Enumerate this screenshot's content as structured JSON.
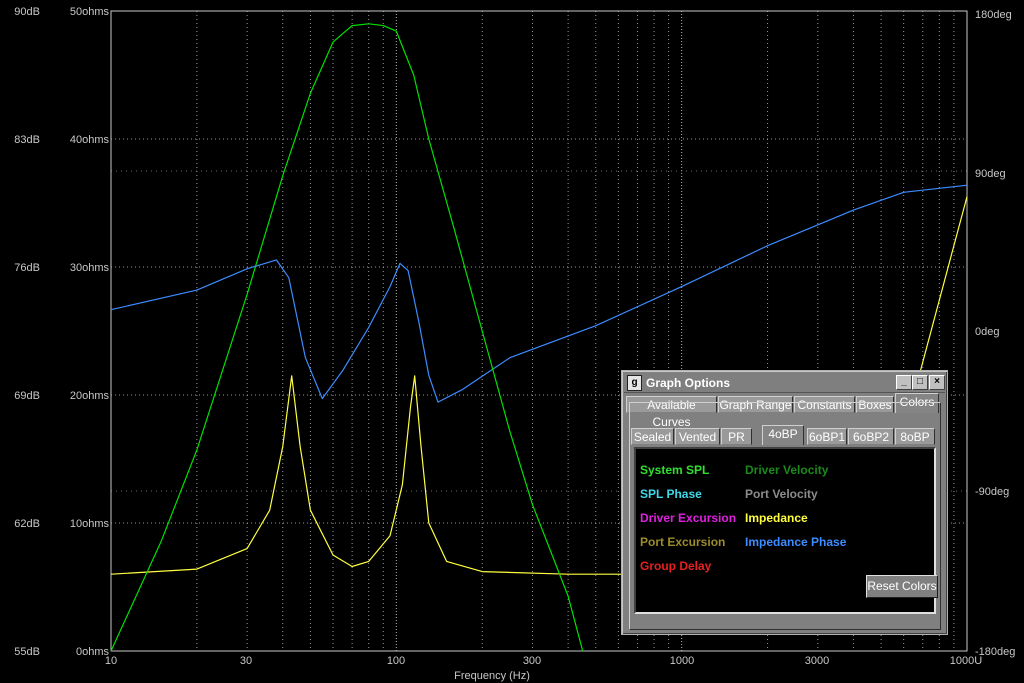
{
  "graph": {
    "left_axis_spl": [
      "90dB",
      "83dB",
      "76dB",
      "69dB",
      "62dB",
      "55dB"
    ],
    "left_axis_impedance": [
      "50ohms",
      "40ohms",
      "30ohms",
      "20ohms",
      "10ohms",
      "0ohms"
    ],
    "right_axis_phase": [
      "180deg",
      "90deg",
      "0deg",
      "-90deg",
      "-180deg"
    ],
    "x_ticks": [
      "10",
      "30",
      "100",
      "300",
      "1000",
      "3000",
      "1000U"
    ],
    "x_label": "Frequency (Hz)",
    "colors": {
      "spl": "#00e000",
      "impedance": "#ffff40",
      "impedance_phase": "#3c8cff",
      "grid": "#9a9a9a",
      "frame": "#c8c8c8"
    },
    "spl_curve": [
      [
        10,
        55
      ],
      [
        15,
        61
      ],
      [
        20,
        66
      ],
      [
        30,
        74.5
      ],
      [
        40,
        81
      ],
      [
        50,
        85.5
      ],
      [
        60,
        88.3
      ],
      [
        70,
        89.2
      ],
      [
        80,
        89.3
      ],
      [
        90,
        89.2
      ],
      [
        100,
        88.9
      ],
      [
        115,
        86.5
      ],
      [
        130,
        83
      ],
      [
        160,
        78
      ],
      [
        200,
        72.5
      ],
      [
        250,
        67
      ],
      [
        300,
        63
      ],
      [
        400,
        58
      ],
      [
        450,
        55
      ]
    ],
    "impedance_curve": [
      [
        10,
        6
      ],
      [
        20,
        6.4
      ],
      [
        30,
        8
      ],
      [
        36,
        11
      ],
      [
        40,
        16
      ],
      [
        43,
        21.5
      ],
      [
        46,
        16
      ],
      [
        50,
        11
      ],
      [
        60,
        7.5
      ],
      [
        70,
        6.6
      ],
      [
        80,
        7
      ],
      [
        95,
        9
      ],
      [
        105,
        13
      ],
      [
        112,
        19
      ],
      [
        116,
        21.5
      ],
      [
        122,
        16
      ],
      [
        130,
        10
      ],
      [
        150,
        7
      ],
      [
        200,
        6.2
      ],
      [
        400,
        6
      ],
      [
        800,
        6
      ],
      [
        1500,
        6.5
      ],
      [
        2500,
        8
      ],
      [
        4000,
        11
      ],
      [
        6000,
        17
      ],
      [
        10000,
        35.5
      ]
    ],
    "phase_curve": [
      [
        10,
        12
      ],
      [
        20,
        23
      ],
      [
        30,
        35
      ],
      [
        38,
        40
      ],
      [
        42,
        30
      ],
      [
        48,
        -15
      ],
      [
        55,
        -38
      ],
      [
        65,
        -22
      ],
      [
        80,
        2
      ],
      [
        95,
        25
      ],
      [
        103,
        38
      ],
      [
        110,
        34
      ],
      [
        120,
        5
      ],
      [
        130,
        -25
      ],
      [
        140,
        -40
      ],
      [
        170,
        -33
      ],
      [
        250,
        -15
      ],
      [
        500,
        3
      ],
      [
        1000,
        25
      ],
      [
        2000,
        48
      ],
      [
        4000,
        68
      ],
      [
        6000,
        78
      ],
      [
        10000,
        82
      ]
    ]
  },
  "dialog": {
    "title": "Graph Options",
    "icon_glyph": "g",
    "minimize": "_",
    "maximize": "□",
    "close": "×",
    "top_tabs": [
      "Available Curves",
      "Graph Range",
      "Constants",
      "Boxes",
      "Colors"
    ],
    "sub_tabs": [
      "Sealed",
      "Vented",
      "PR",
      "4oBP",
      "6oBP1",
      "6oBP2",
      "8oBP"
    ],
    "color_labels": [
      {
        "text": "System SPL",
        "color": "#30e030"
      },
      {
        "text": "Driver Velocity",
        "color": "#1a8a1a"
      },
      {
        "text": "SPL Phase",
        "color": "#40d8e8"
      },
      {
        "text": "Port Velocity",
        "color": "#8c8c8c"
      },
      {
        "text": "Driver Excursion",
        "color": "#e020e0"
      },
      {
        "text": "Impedance",
        "color": "#ffff40"
      },
      {
        "text": "Port Excursion",
        "color": "#9c8c2c"
      },
      {
        "text": "Impedance Phase",
        "color": "#3c8cff"
      },
      {
        "text": "Group Delay",
        "color": "#e82020"
      }
    ],
    "reset_button": "Reset Colors"
  }
}
